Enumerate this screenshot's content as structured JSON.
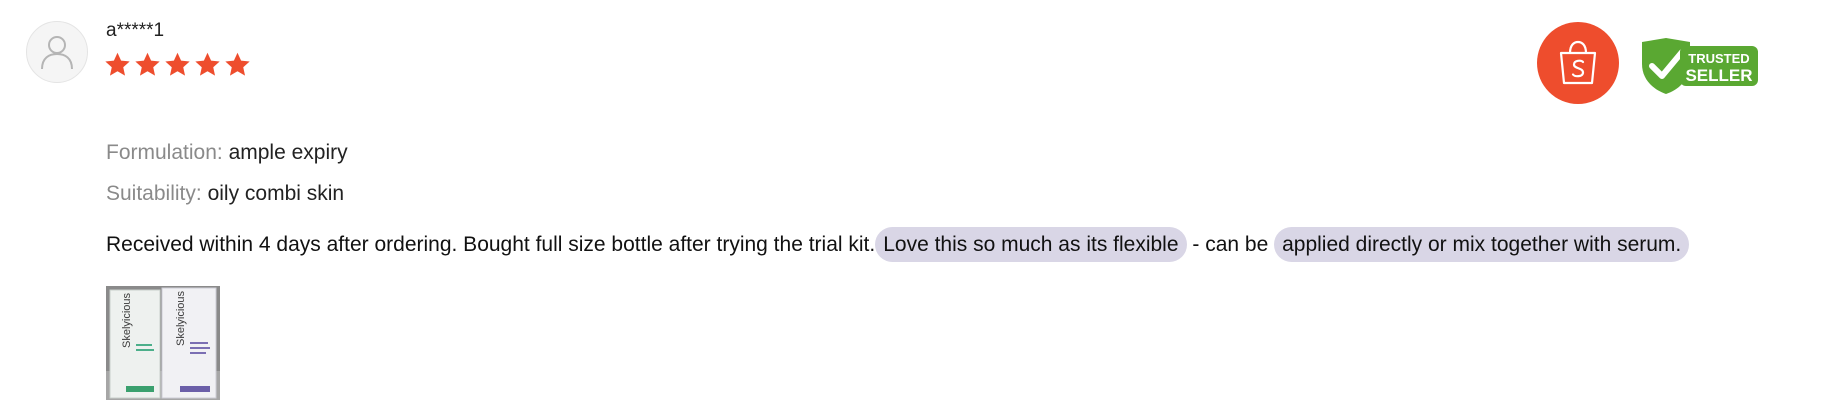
{
  "reviewer": {
    "username": "a*****1",
    "rating": 5,
    "avatar_icon": "user-avatar-icon"
  },
  "badges": {
    "shopee_icon": "shopee-bag-icon",
    "trusted_line1": "TRUSTED",
    "trusted_line2": "SELLER"
  },
  "attributes": {
    "formulation_label": "Formulation:",
    "formulation_value": "ample expiry",
    "suitability_label": "Suitability:",
    "suitability_value": "oily combi skin"
  },
  "comment": {
    "part1": "Received within 4 days after ordering. Bought full size bottle after trying the trial kit.",
    "highlight1": "Love this so much as its flexible",
    "part2": " - can be ",
    "highlight2": "applied directly or mix together with serum."
  },
  "photo": {
    "brand_text": "Skelyicious"
  },
  "colors": {
    "star": "#ee4d2d",
    "shopee": "#ee4d2d",
    "trusted_green": "#5aa832",
    "highlight": "#d9d6e6",
    "label_gray": "#8a8a8a"
  }
}
